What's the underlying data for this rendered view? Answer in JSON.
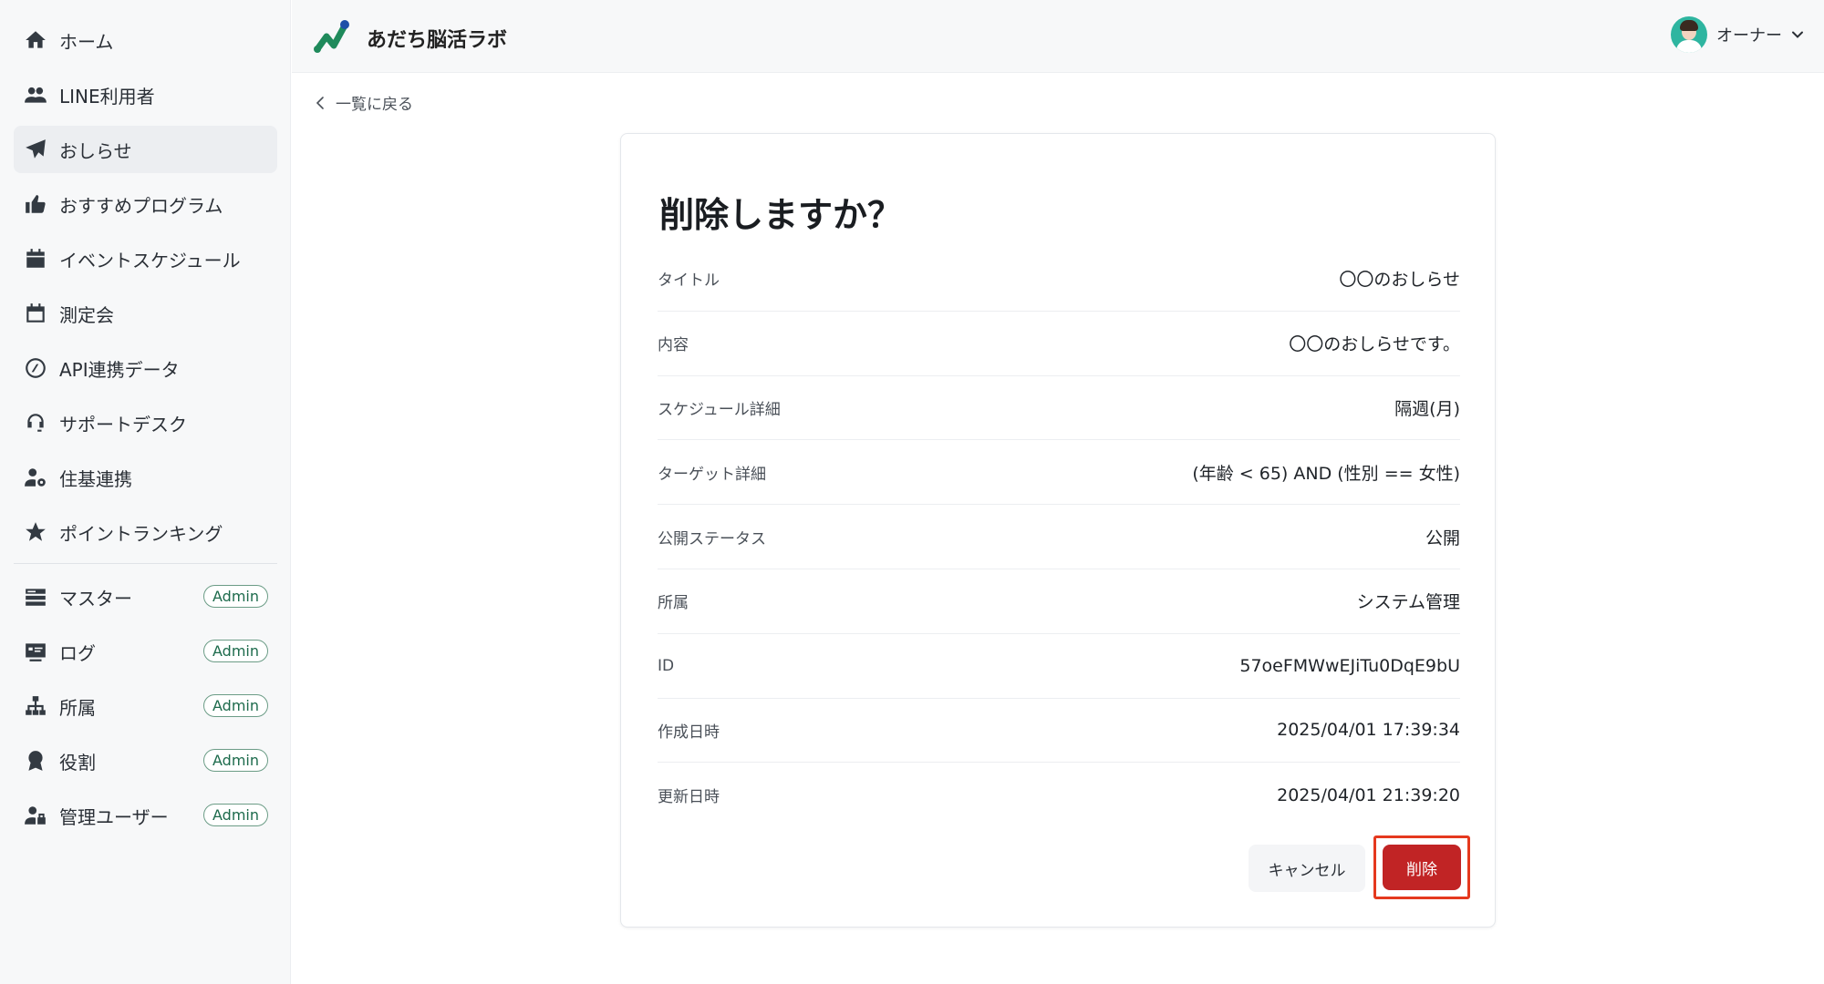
{
  "brand": {
    "name": "あだち脳活ラボ",
    "accent": "#1f8a5b"
  },
  "user": {
    "name": "オーナー"
  },
  "sidebar": {
    "items": [
      {
        "label": "ホーム",
        "icon": "home-icon"
      },
      {
        "label": "LINE利用者",
        "icon": "users-icon"
      },
      {
        "label": "おしらせ",
        "icon": "paper-plane-icon"
      },
      {
        "label": "おすすめプログラム",
        "icon": "thumbs-up-icon"
      },
      {
        "label": "イベントスケジュール",
        "icon": "calendar-filled-icon"
      },
      {
        "label": "測定会",
        "icon": "calendar-outline-icon"
      },
      {
        "label": "API連携データ",
        "icon": "api-icon"
      },
      {
        "label": "サポートデスク",
        "icon": "headset-icon"
      },
      {
        "label": "住基連携",
        "icon": "user-gear-icon"
      },
      {
        "label": "ポイントランキング",
        "icon": "star-icon"
      }
    ],
    "admin_items": [
      {
        "label": "マスター",
        "icon": "master-icon",
        "badge": "Admin"
      },
      {
        "label": "ログ",
        "icon": "log-icon",
        "badge": "Admin"
      },
      {
        "label": "所属",
        "icon": "org-icon",
        "badge": "Admin"
      },
      {
        "label": "役割",
        "icon": "award-icon",
        "badge": "Admin"
      },
      {
        "label": "管理ユーザー",
        "icon": "admin-user-icon",
        "badge": "Admin"
      }
    ]
  },
  "back_link": "一覧に戻る",
  "dialog": {
    "title": "削除しますか？",
    "rows": [
      {
        "label": "タイトル",
        "value": "〇〇のおしらせ"
      },
      {
        "label": "内容",
        "value": "〇〇のおしらせです。"
      },
      {
        "label": "スケジュール詳細",
        "value": "隔週(月)"
      },
      {
        "label": "ターゲット詳細",
        "value": "(年齢 < 65) AND (性別 == 女性)"
      },
      {
        "label": "公開ステータス",
        "value": "公開"
      },
      {
        "label": "所属",
        "value": "システム管理"
      },
      {
        "label": "ID",
        "value": "57oeFMWwEJiTu0DqE9bU"
      },
      {
        "label": "作成日時",
        "value": "2025/04/01 17:39:34"
      },
      {
        "label": "更新日時",
        "value": "2025/04/01 21:39:20"
      }
    ],
    "cancel_label": "キャンセル",
    "delete_label": "削除",
    "delete_color": "#c12425",
    "highlight_color": "#e5391e"
  }
}
